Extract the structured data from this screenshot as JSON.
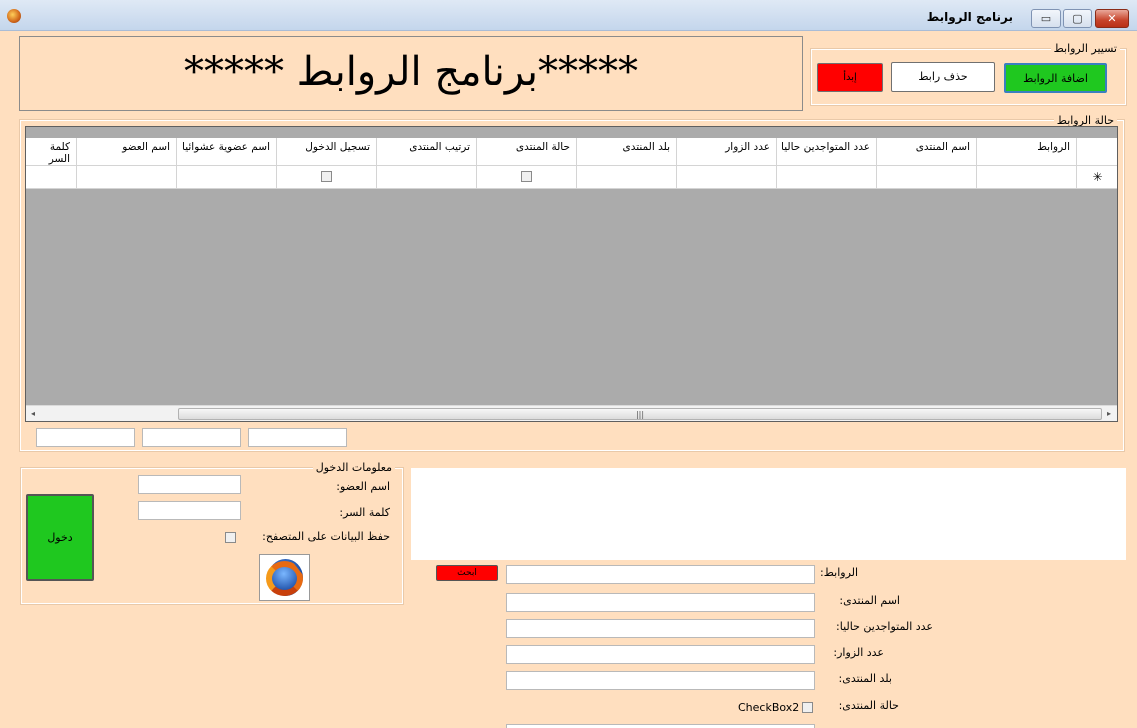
{
  "window": {
    "title": "برنامج الروابط",
    "min": "▭",
    "max": "▢",
    "close": "✕"
  },
  "banner": {
    "text": "*****برنامج الروابط *****"
  },
  "links_group": {
    "label": "تسيير الروابط",
    "add": "اضافة الروابط",
    "delete": "حذف رابط",
    "start": "إبدأ"
  },
  "status_group": {
    "label": "حالة الروابط"
  },
  "grid": {
    "columns": [
      "الروابط",
      "اسم المنتدى",
      "عدد المتواجدين حاليا",
      "عدد الزوار",
      "بلد المنتدى",
      "حالة المنتدى",
      "ترتيب المنتدى",
      "تسجيل الدخول",
      "اسم عضوية عشوائيا",
      "اسم العضو",
      "كلمة السر"
    ],
    "new_row_marker": "✳",
    "scroll_grip": "|||",
    "scroll_left": "◂",
    "scroll_right": "▸"
  },
  "login": {
    "label": "معلومات الدخول",
    "member_label": "اسم العضو:",
    "password_label": "كلمة السر:",
    "save_label": "حفظ البيانات على المتصفح:",
    "login_button": "دخول"
  },
  "details": {
    "search_button": "ابحث",
    "links_label": "الروابط:",
    "forum_name_label": "اسم المنتدى:",
    "online_label": "عدد المتواجدين حاليا:",
    "visitors_label": "عدد الزوار:",
    "country_label": "بلد المنتدى:",
    "forum_state_label": "حالة المنتدى:",
    "checkbox2": "CheckBox2"
  }
}
